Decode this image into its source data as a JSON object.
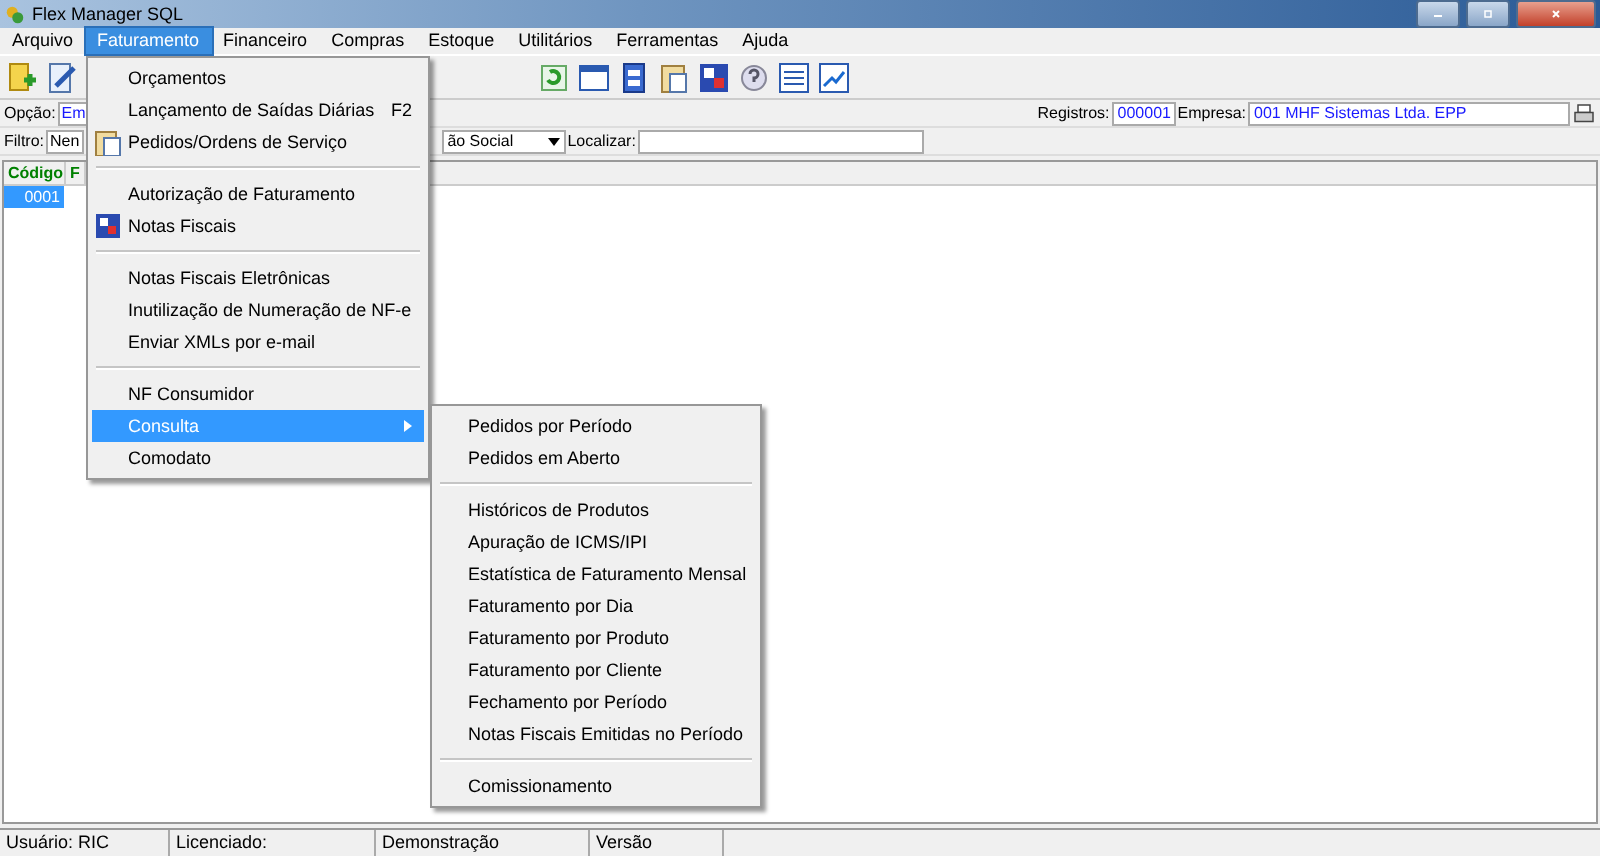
{
  "window": {
    "title": "Flex Manager SQL"
  },
  "menu_bar": [
    {
      "label": "Arquivo",
      "selected": false
    },
    {
      "label": "Faturamento",
      "selected": true
    },
    {
      "label": "Financeiro",
      "selected": false
    },
    {
      "label": "Compras",
      "selected": false
    },
    {
      "label": "Estoque",
      "selected": false
    },
    {
      "label": "Utilitários",
      "selected": false
    },
    {
      "label": "Ferramentas",
      "selected": false
    },
    {
      "label": "Ajuda",
      "selected": false
    }
  ],
  "option_row": {
    "label": "Opção:",
    "value": "Em",
    "registros_label": "Registros:",
    "registros_value": "000001",
    "empresa_label": "Empresa:",
    "empresa_value": "001 MHF Sistemas Ltda. EPP"
  },
  "filter_row": {
    "label": "Filtro:",
    "value": "Nen",
    "column_value": "ão Social",
    "search_label": "Localizar:"
  },
  "grid": {
    "columns": [
      "Código",
      "F"
    ],
    "rows": [
      {
        "cells": [
          "0001"
        ],
        "selected": true
      }
    ]
  },
  "menu": [
    {
      "kind": "item",
      "label": "Orçamentos",
      "selected": false
    },
    {
      "kind": "item",
      "label": "Lançamento de Saídas Diárias",
      "shortcut": "F2",
      "selected": false
    },
    {
      "kind": "clipboard",
      "label": "Pedidos/Ordens de Serviço",
      "selected": false
    },
    {
      "kind": "separator"
    },
    {
      "kind": "item",
      "label": "Autorização de Faturamento",
      "selected": false
    },
    {
      "kind": "form",
      "label": "Notas Fiscais",
      "selected": false
    },
    {
      "kind": "separator"
    },
    {
      "kind": "item",
      "label": "Notas Fiscais Eletrônicas",
      "selected": false
    },
    {
      "kind": "item",
      "label": "Inutilização de Numeração de NF-e",
      "selected": false
    },
    {
      "kind": "item",
      "label": "Enviar XMLs por e-mail",
      "selected": false
    },
    {
      "kind": "separator"
    },
    {
      "kind": "item",
      "label": "NF Consumidor",
      "selected": false
    },
    {
      "kind": "submenu",
      "label": "Consulta",
      "selected": true
    },
    {
      "kind": "item",
      "label": "Comodato",
      "selected": false
    }
  ],
  "submenu": [
    {
      "kind": "item",
      "label": "Pedidos por Período",
      "selected": false
    },
    {
      "kind": "item",
      "label": "Pedidos em Aberto",
      "selected": false
    },
    {
      "kind": "separator"
    },
    {
      "kind": "item",
      "label": "Históricos de Produtos",
      "selected": false
    },
    {
      "kind": "item",
      "label": "Apuração de ICMS/IPI",
      "selected": false
    },
    {
      "kind": "item",
      "label": "Estatística de Faturamento Mensal",
      "selected": false
    },
    {
      "kind": "item",
      "label": "Faturamento por Dia",
      "selected": false
    },
    {
      "kind": "item",
      "label": "Faturamento por Produto",
      "selected": false
    },
    {
      "kind": "item",
      "label": "Faturamento por Cliente",
      "selected": false
    },
    {
      "kind": "item",
      "label": "Fechamento por Período",
      "selected": false
    },
    {
      "kind": "item",
      "label": "Notas Fiscais Emitidas no Período",
      "selected": false
    },
    {
      "kind": "separator"
    },
    {
      "kind": "item",
      "label": "Comissionamento",
      "selected": false
    }
  ],
  "status_bar": [
    "Usuário: RIC",
    "Licenciado:",
    "Demonstração",
    "Versão"
  ]
}
